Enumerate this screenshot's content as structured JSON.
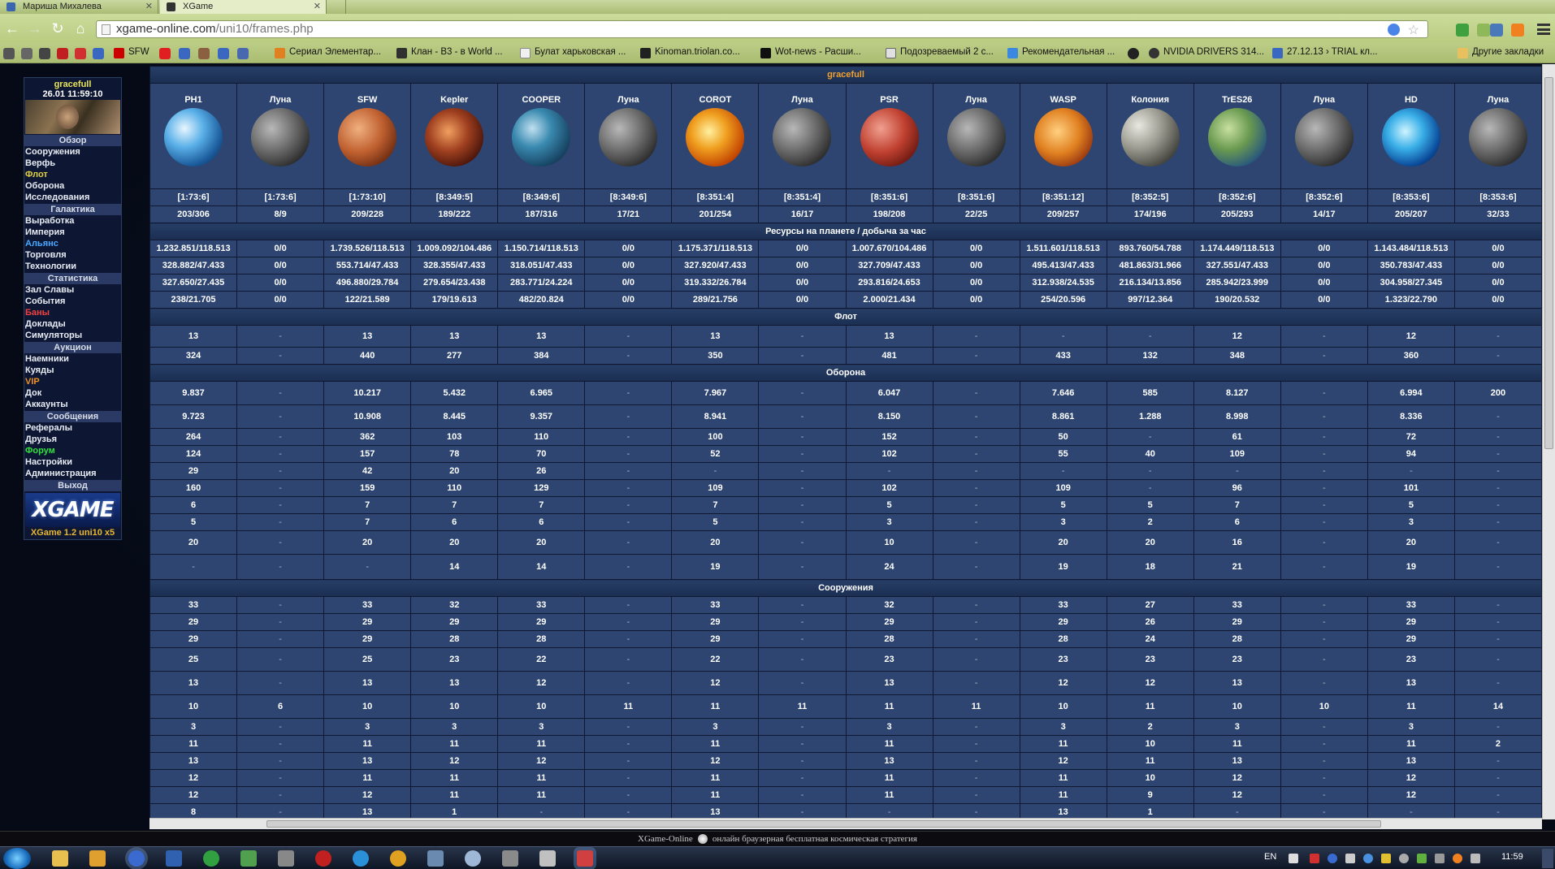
{
  "browser": {
    "tabs": [
      {
        "label": "Мариша Михалева",
        "active": false
      },
      {
        "label": "XGame",
        "active": true
      }
    ],
    "url_host": "xgame-online.com",
    "url_path": "/uni10/frames.php",
    "bookmarks": [
      {
        "label": "SFW"
      },
      {
        "label": "Сериал Элементар..."
      },
      {
        "label": "Клан - B3 - в World ..."
      },
      {
        "label": "Булат харьковская ..."
      },
      {
        "label": "Kinoman.triolan.co..."
      },
      {
        "label": "Wot-news - Расши..."
      },
      {
        "label": "Подозреваемый 2 с..."
      },
      {
        "label": "Рекомендательная ..."
      },
      {
        "label": "NVIDIA DRIVERS 314..."
      },
      {
        "label": "27.12.13 › TRIAL кл..."
      },
      {
        "label": "Другие закладки"
      }
    ]
  },
  "sidebar": {
    "user": "gracefull",
    "datetime": "26.01 11:59:10",
    "sections": [
      {
        "title": "Обзор",
        "items": [
          {
            "label": "Сооружения",
            "color": "white"
          },
          {
            "label": "Верфь",
            "color": "white"
          },
          {
            "label": "Флот",
            "color": "yellow"
          },
          {
            "label": "Оборона",
            "color": "white"
          },
          {
            "label": "Исследования",
            "color": "white"
          }
        ]
      },
      {
        "title": "Галактика",
        "items": [
          {
            "label": "Выработка",
            "color": "white"
          },
          {
            "label": "Империя",
            "color": "white"
          },
          {
            "label": "Альянс",
            "color": "blue"
          },
          {
            "label": "Торговля",
            "color": "white"
          },
          {
            "label": "Технологии",
            "color": "white"
          }
        ]
      },
      {
        "title": "Статистика",
        "items": [
          {
            "label": "Зал Славы",
            "color": "white"
          },
          {
            "label": "События",
            "color": "white"
          },
          {
            "label": "Баны",
            "color": "red"
          },
          {
            "label": "Доклады",
            "color": "white"
          },
          {
            "label": "Симуляторы",
            "color": "white"
          }
        ]
      },
      {
        "title": "Аукцион",
        "items": [
          {
            "label": "Наемники",
            "color": "white"
          },
          {
            "label": "Куяды",
            "color": "white"
          },
          {
            "label": "VIP",
            "color": "orange"
          },
          {
            "label": "Док",
            "color": "white"
          },
          {
            "label": "Аккаунты",
            "color": "white"
          }
        ]
      },
      {
        "title": "Сообщения",
        "items": [
          {
            "label": "Рефералы",
            "color": "white"
          },
          {
            "label": "Друзья",
            "color": "white"
          },
          {
            "label": "Форум",
            "color": "green"
          },
          {
            "label": "Настройки",
            "color": "white"
          },
          {
            "label": "Администрация",
            "color": "white"
          }
        ]
      },
      {
        "title": "Выход",
        "items": []
      }
    ],
    "logo": "XGAME",
    "footer": "XGame 1.2 uni10 x5"
  },
  "overview": {
    "owner": "gracefull",
    "planets": [
      {
        "name": "PH1",
        "coords": "[1:73:6]",
        "fields": "203/306",
        "kind": "earth"
      },
      {
        "name": "Луна",
        "coords": "[1:73:6]",
        "fields": "8/9",
        "kind": "moon"
      },
      {
        "name": "SFW",
        "coords": "[1:73:10]",
        "fields": "209/228",
        "kind": "mars"
      },
      {
        "name": "Kepler",
        "coords": "[8:349:5]",
        "fields": "189/222",
        "kind": "lava"
      },
      {
        "name": "COOPER",
        "coords": "[8:349:6]",
        "fields": "187/316",
        "kind": "ocean"
      },
      {
        "name": "Луна",
        "coords": "[8:349:6]",
        "fields": "17/21",
        "kind": "moon"
      },
      {
        "name": "COROT",
        "coords": "[8:351:4]",
        "fields": "201/254",
        "kind": "fire"
      },
      {
        "name": "Луна",
        "coords": "[8:351:4]",
        "fields": "16/17",
        "kind": "moon"
      },
      {
        "name": "PSR",
        "coords": "[8:351:6]",
        "fields": "198/208",
        "kind": "red"
      },
      {
        "name": "Луна",
        "coords": "[8:351:6]",
        "fields": "22/25",
        "kind": "moon"
      },
      {
        "name": "WASP",
        "coords": "[8:351:12]",
        "fields": "209/257",
        "kind": "gas"
      },
      {
        "name": "Колония",
        "coords": "[8:352:5]",
        "fields": "174/196",
        "kind": "grey"
      },
      {
        "name": "TrES26",
        "coords": "[8:352:6]",
        "fields": "205/293",
        "kind": "green"
      },
      {
        "name": "Луна",
        "coords": "[8:352:6]",
        "fields": "14/17",
        "kind": "moon"
      },
      {
        "name": "HD",
        "coords": "[8:353:6]",
        "fields": "205/207",
        "kind": "blue"
      },
      {
        "name": "Луна",
        "coords": "[8:353:6]",
        "fields": "32/33",
        "kind": "moon"
      }
    ],
    "resources_title": "Ресурсы на планете / добыча за час",
    "resources": [
      [
        "1.232.851/118.513",
        "0/0",
        "1.739.526/118.513",
        "1.009.092/104.486",
        "1.150.714/118.513",
        "0/0",
        "1.175.371/118.513",
        "0/0",
        "1.007.670/104.486",
        "0/0",
        "1.511.601/118.513",
        "893.760/54.788",
        "1.174.449/118.513",
        "0/0",
        "1.143.484/118.513",
        "0/0"
      ],
      [
        "328.882/47.433",
        "0/0",
        "553.714/47.433",
        "328.355/47.433",
        "318.051/47.433",
        "0/0",
        "327.920/47.433",
        "0/0",
        "327.709/47.433",
        "0/0",
        "495.413/47.433",
        "481.863/31.966",
        "327.551/47.433",
        "0/0",
        "350.783/47.433",
        "0/0"
      ],
      [
        "327.650/27.435",
        "0/0",
        "496.880/29.784",
        "279.654/23.438",
        "283.771/24.224",
        "0/0",
        "319.332/26.784",
        "0/0",
        "293.816/24.653",
        "0/0",
        "312.938/24.535",
        "216.134/13.856",
        "285.942/23.999",
        "0/0",
        "304.958/27.345",
        "0/0"
      ],
      [
        "238/21.705",
        "0/0",
        "122/21.589",
        "179/19.613",
        "482/20.824",
        "0/0",
        "289/21.756",
        "0/0",
        "2.000/21.434",
        "0/0",
        "254/20.596",
        "997/12.364",
        "190/20.532",
        "0/0",
        "1.323/22.790",
        "0/0"
      ]
    ],
    "fleet_title": "Флот",
    "fleet": [
      [
        "13",
        "-",
        "13",
        "13",
        "13",
        "-",
        "13",
        "-",
        "13",
        "-",
        "-",
        "-",
        "12",
        "-",
        "12",
        "-"
      ],
      [
        "324",
        "-",
        "440",
        "277",
        "384",
        "-",
        "350",
        "-",
        "481",
        "-",
        "433",
        "132",
        "348",
        "-",
        "360",
        "-"
      ]
    ],
    "defense_title": "Оборона",
    "defense": [
      [
        "9.837",
        "-",
        "10.217",
        "5.432",
        "6.965",
        "-",
        "7.967",
        "-",
        "6.047",
        "-",
        "7.646",
        "585",
        "8.127",
        "-",
        "6.994",
        "200"
      ],
      [
        "9.723",
        "-",
        "10.908",
        "8.445",
        "9.357",
        "-",
        "8.941",
        "-",
        "8.150",
        "-",
        "8.861",
        "1.288",
        "8.998",
        "-",
        "8.336",
        "-"
      ],
      [
        "264",
        "-",
        "362",
        "103",
        "110",
        "-",
        "100",
        "-",
        "152",
        "-",
        "50",
        "-",
        "61",
        "-",
        "72",
        "-"
      ],
      [
        "124",
        "-",
        "157",
        "78",
        "70",
        "-",
        "52",
        "-",
        "102",
        "-",
        "55",
        "40",
        "109",
        "-",
        "94",
        "-"
      ],
      [
        "29",
        "-",
        "42",
        "20",
        "26",
        "-",
        "-",
        "-",
        "-",
        "-",
        "-",
        "-",
        "-",
        "-",
        "-",
        "-"
      ],
      [
        "160",
        "-",
        "159",
        "110",
        "129",
        "-",
        "109",
        "-",
        "102",
        "-",
        "109",
        "-",
        "96",
        "-",
        "101",
        "-"
      ],
      [
        "6",
        "-",
        "7",
        "7",
        "7",
        "-",
        "7",
        "-",
        "5",
        "-",
        "5",
        "5",
        "7",
        "-",
        "5",
        "-"
      ],
      [
        "5",
        "-",
        "7",
        "6",
        "6",
        "-",
        "5",
        "-",
        "3",
        "-",
        "3",
        "2",
        "6",
        "-",
        "3",
        "-"
      ],
      [
        "20",
        "-",
        "20",
        "20",
        "20",
        "-",
        "20",
        "-",
        "10",
        "-",
        "20",
        "20",
        "16",
        "-",
        "20",
        "-"
      ],
      [
        "-",
        "-",
        "-",
        "14",
        "14",
        "-",
        "19",
        "-",
        "24",
        "-",
        "19",
        "18",
        "21",
        "-",
        "19",
        "-"
      ]
    ],
    "buildings_title": "Сооружения",
    "buildings": [
      [
        "33",
        "-",
        "33",
        "32",
        "33",
        "-",
        "33",
        "-",
        "32",
        "-",
        "33",
        "27",
        "33",
        "-",
        "33",
        "-"
      ],
      [
        "29",
        "-",
        "29",
        "29",
        "29",
        "-",
        "29",
        "-",
        "29",
        "-",
        "29",
        "26",
        "29",
        "-",
        "29",
        "-"
      ],
      [
        "29",
        "-",
        "29",
        "28",
        "28",
        "-",
        "29",
        "-",
        "28",
        "-",
        "28",
        "24",
        "28",
        "-",
        "29",
        "-"
      ],
      [
        "25",
        "-",
        "25",
        "23",
        "22",
        "-",
        "22",
        "-",
        "23",
        "-",
        "23",
        "23",
        "23",
        "-",
        "23",
        "-"
      ],
      [
        "13",
        "-",
        "13",
        "13",
        "12",
        "-",
        "12",
        "-",
        "13",
        "-",
        "12",
        "12",
        "13",
        "-",
        "13",
        "-"
      ],
      [
        "10",
        "6",
        "10",
        "10",
        "10",
        "11",
        "11",
        "11",
        "11",
        "11",
        "10",
        "11",
        "10",
        "10",
        "11",
        "14"
      ],
      [
        "3",
        "-",
        "3",
        "3",
        "3",
        "-",
        "3",
        "-",
        "3",
        "-",
        "3",
        "2",
        "3",
        "-",
        "3",
        "-"
      ],
      [
        "11",
        "-",
        "11",
        "11",
        "11",
        "-",
        "11",
        "-",
        "11",
        "-",
        "11",
        "10",
        "11",
        "-",
        "11",
        "2"
      ],
      [
        "13",
        "-",
        "13",
        "12",
        "12",
        "-",
        "12",
        "-",
        "13",
        "-",
        "12",
        "11",
        "13",
        "-",
        "13",
        "-"
      ],
      [
        "12",
        "-",
        "11",
        "11",
        "11",
        "-",
        "11",
        "-",
        "11",
        "-",
        "11",
        "10",
        "12",
        "-",
        "12",
        "-"
      ],
      [
        "12",
        "-",
        "12",
        "11",
        "11",
        "-",
        "11",
        "-",
        "11",
        "-",
        "11",
        "9",
        "12",
        "-",
        "12",
        "-"
      ],
      [
        "8",
        "-",
        "13",
        "1",
        "-",
        "-",
        "13",
        "-",
        "-",
        "-",
        "13",
        "1",
        "-",
        "-",
        "-",
        "-"
      ]
    ]
  },
  "statusbar": {
    "left": "XGame-Online",
    "right": "онлайн браузерная бесплатная космическая стратегия"
  },
  "taskbar": {
    "lang": "EN",
    "clock": "11:59"
  }
}
